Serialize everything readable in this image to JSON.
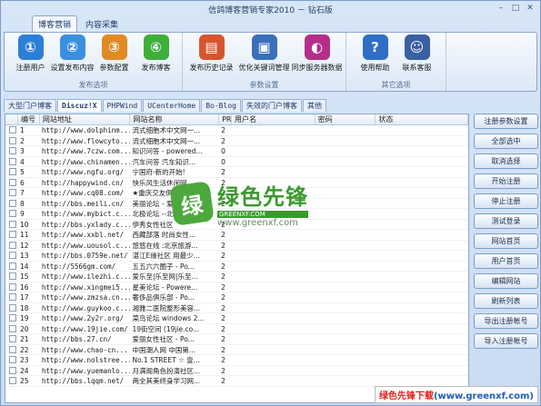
{
  "window": {
    "title": "信鸽博客营销专家2010 － 钻石版",
    "controls": [
      "–",
      "□",
      "✕"
    ]
  },
  "ribbon_tabs": [
    {
      "label": "博客营销",
      "active": true
    },
    {
      "label": "内容采集",
      "active": false
    }
  ],
  "groups": [
    {
      "label": "发布选项",
      "buttons": [
        {
          "label": "注册用户",
          "icon": "register-user-icon",
          "color": "#2c7fd6",
          "glyph": "①"
        },
        {
          "label": "设置发布内容",
          "icon": "settings-content-icon",
          "color": "#3c8fe0",
          "glyph": "②"
        },
        {
          "label": "参数配置",
          "icon": "param-config-icon",
          "color": "#e08b24",
          "glyph": "③"
        },
        {
          "label": "发布博客",
          "icon": "publish-blog-icon",
          "color": "#3fae3a",
          "glyph": "④"
        }
      ]
    },
    {
      "label": "参数设置",
      "buttons": [
        {
          "label": "发布历史记录",
          "icon": "history-books-icon",
          "color": "#d7552e",
          "glyph": "▤"
        },
        {
          "label": "优化关键词管理",
          "icon": "keyword-box-icon",
          "color": "#3a70b8",
          "glyph": "▣"
        },
        {
          "label": "同步服务器数据",
          "icon": "sync-server-icon",
          "color": "#b42f8a",
          "glyph": "◐"
        }
      ]
    },
    {
      "label": "其它选项",
      "buttons": [
        {
          "label": "使用帮助",
          "icon": "help-icon",
          "color": "#2f6fc3",
          "glyph": "?"
        },
        {
          "label": "联系客服",
          "icon": "contact-support-icon",
          "color": "#3b5fa3",
          "glyph": "☺"
        }
      ]
    }
  ],
  "sub_tabs": [
    {
      "label": "大型门户博客",
      "active": false,
      "mono": false
    },
    {
      "label": "Discuz!X",
      "active": true,
      "mono": true
    },
    {
      "label": "PHPWind",
      "active": false,
      "mono": true
    },
    {
      "label": "UCenterHome",
      "active": false,
      "mono": true
    },
    {
      "label": "Bo-Blog",
      "active": false,
      "mono": true
    },
    {
      "label": "失效的门户博客",
      "active": false,
      "mono": false
    },
    {
      "label": "其他",
      "active": false,
      "mono": false
    }
  ],
  "table": {
    "columns": [
      "",
      "编号",
      "网站地址",
      "网站名称",
      "PR",
      "用户名",
      "密码",
      "状态"
    ],
    "rows": [
      [
        "1",
        "http://www.dolphinm...",
        "流式细胞术中文网一...",
        "2"
      ],
      [
        "2",
        "http://www.flowcyto...",
        "流式细胞术中文网一...",
        "2"
      ],
      [
        "3",
        "http://www.7czw.com...",
        "知识问答 - powered...",
        "0"
      ],
      [
        "4",
        "http://www.chinamen...",
        "汽车问答 汽车知识...",
        "0"
      ],
      [
        "5",
        "http://www.ngfu.org/",
        "宁国府-新的开始!",
        "2"
      ],
      [
        "6",
        "http://happywind.cn/",
        "快乐风生活休闲网",
        "2"
      ],
      [
        "7",
        "http://www.cq08.com/",
        "★重庆交友俱乐部★...",
        "2"
      ],
      [
        "8",
        "http://bbs.meili.cn/",
        "美丽论坛 - 爱美丽...",
        "2"
      ],
      [
        "9",
        "http://www.mybict.c...",
        "北极论坛 --北京...",
        "2"
      ],
      [
        "10",
        "http://bbs.yxlady.c...",
        "伊秀女性社区",
        "2"
      ],
      [
        "11",
        "http://www.xxbl.net/",
        "西藏部落 时尚女性...",
        "2"
      ],
      [
        "12",
        "http://www.uousol.c...",
        "悠悠在线 :北京旅游...",
        "2"
      ],
      [
        "13",
        "http://bbs.0759e.net/",
        "湛江E缘社区 用最少...",
        "2"
      ],
      [
        "14",
        "http://5566gm.com/",
        "五五六六圈子 - Po...",
        "2"
      ],
      [
        "15",
        "http://www.ilezhi.c...",
        "爱乐至|乐至网|乐至...",
        "2"
      ],
      [
        "16",
        "http://www.xingmei5...",
        "星美论坛 - Powere...",
        "2"
      ],
      [
        "17",
        "http://www.zmzsa.cn...",
        "奢侈品俱乐部 - Po...",
        "2"
      ],
      [
        "18",
        "http://www.guykoo.c...",
        "湘雅二医院整形美容...",
        "2"
      ],
      [
        "19",
        "http://www.2y2r.org/",
        "菜鸟论坛 windows 2...",
        "2"
      ],
      [
        "20",
        "http://www.19jie.com/",
        "19街空间 (19jie.co...",
        "2"
      ],
      [
        "21",
        "http://bbs.27.cn/",
        "爱丽女性社区 - Po...",
        "2"
      ],
      [
        "22",
        "http://www.chao-cn...",
        "中国潮人网 中国第...",
        "2"
      ],
      [
        "23",
        "http://www.nolstree...",
        "No.1 STREET ☆ 壹...",
        "2"
      ],
      [
        "24",
        "http://www.yuemanlo...",
        "月满阁角色扮演社区...",
        "2"
      ],
      [
        "25",
        "http://bbs.lqqm.net/",
        "两全其美终身学习网...",
        "2"
      ]
    ]
  },
  "side_buttons": [
    "注册参数设置",
    "全部选中",
    "取消选择",
    "开始注册",
    "停止注册",
    "测试登录",
    "网站首页",
    "用户首页",
    "编辑网站",
    "刷新列表",
    "导出注册帐号",
    "导入注册帐号"
  ],
  "watermark": {
    "logo": "绿",
    "title": "绿色先锋",
    "url": "www.greenxf.com",
    "sub": "GREENXF.COM"
  },
  "banner": {
    "left": "绿色先锋下载",
    "right": "(www.greenxf.com)"
  }
}
